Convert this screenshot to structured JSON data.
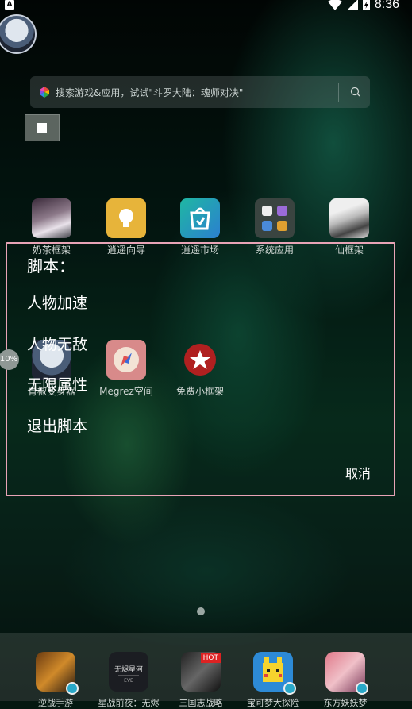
{
  "status_bar": {
    "indicator": "A",
    "time": "8:36"
  },
  "search": {
    "placeholder": "搜索游戏&应用，试试\"斗罗大陆：魂师对决\""
  },
  "apps_row1": [
    {
      "label": "奶茶框架",
      "icon": "anime-character-icon"
    },
    {
      "label": "逍遥向导",
      "icon": "lightbulb-icon"
    },
    {
      "label": "逍遥市场",
      "icon": "store-bag-icon"
    },
    {
      "label": "系统应用",
      "icon": "folder-icon"
    },
    {
      "label": "仙框架",
      "icon": "anime-sketch-icon"
    }
  ],
  "apps_row2": [
    {
      "label": "青椒变身器",
      "icon": "avatar-icon"
    },
    {
      "label": "Megrez空间",
      "icon": "compass-icon"
    },
    {
      "label": "免费小框架",
      "icon": "star-icon"
    }
  ],
  "dialog": {
    "title": "脚本：",
    "items": [
      "人物加速",
      "人物无敌",
      "无限属性",
      "退出脚本"
    ],
    "cancel": "取消"
  },
  "float_badge": "10%",
  "dock": [
    {
      "label": "逆战手游",
      "icon": "game-emblem-icon"
    },
    {
      "label": "星战前夜：无烬",
      "icon": "eve-logo-icon"
    },
    {
      "label": "三国志战略",
      "icon": "hot-game-icon"
    },
    {
      "label": "宝可梦大探险",
      "icon": "pikachu-icon"
    },
    {
      "label": "东方妖妖梦",
      "icon": "anime-girl-icon"
    }
  ]
}
